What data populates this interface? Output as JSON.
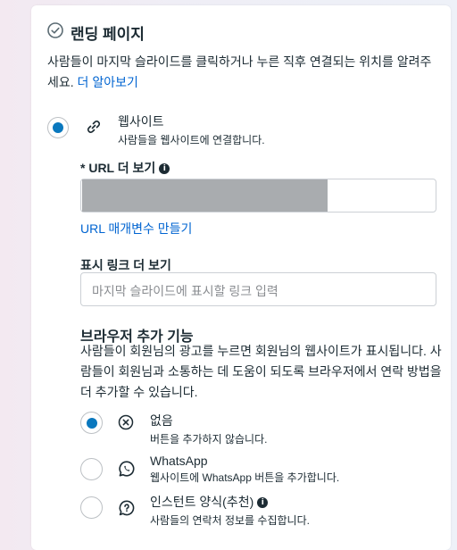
{
  "section": {
    "title": "랜딩 페이지",
    "description": "사람들이 마지막 슬라이드를 클릭하거나 누른 직후 연결되는 위치를 알려주세요.",
    "learn_more": "더 알아보기"
  },
  "website_option": {
    "title": "웹사이트",
    "subtitle": "사람들을 웹사이트에 연결합니다.",
    "selected": true
  },
  "url_field": {
    "label": "* URL 더 보기",
    "value": "",
    "build_params_link": "URL 매개변수 만들기"
  },
  "display_link": {
    "label": "표시 링크 더 보기",
    "placeholder": "마지막 슬라이드에 표시할 링크 입력"
  },
  "browser_addons": {
    "title": "브라우저 추가 기능",
    "description": "사람들이 회원님의 광고를 누르면 회원님의 웹사이트가 표시됩니다. 사람들이 회원님과 소통하는 데 도움이 되도록 브라우저에서 연락 방법을 더 추가할 수 있습니다.",
    "options": [
      {
        "title": "없음",
        "subtitle": "버튼을 추가하지 않습니다.",
        "icon": "circle-x-icon",
        "selected": true
      },
      {
        "title": "WhatsApp",
        "subtitle": "웹사이트에 WhatsApp 버튼을 추가합니다.",
        "icon": "whatsapp-icon",
        "selected": false
      },
      {
        "title": "인스턴트 양식(추천)",
        "subtitle": "사람들의 연락처 정보를 수집합니다.",
        "icon": "chat-question-icon",
        "selected": false
      }
    ]
  },
  "colors": {
    "accent": "#0a78be",
    "link": "#0064d1",
    "success": "#2e7d32"
  }
}
